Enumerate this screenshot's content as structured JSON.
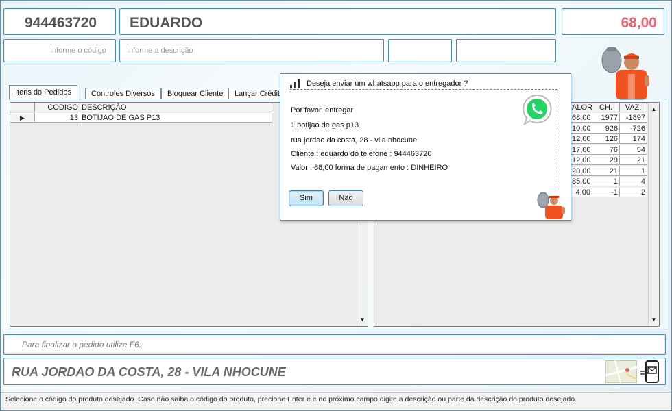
{
  "header": {
    "phone": "944463720",
    "customer_name": "EDUARDO",
    "total": "68,00"
  },
  "inputs": {
    "code_placeholder": "Informe o código",
    "description_placeholder": "Informe a descrição",
    "field3_value": "",
    "field4_value": ""
  },
  "tabs": [
    {
      "label": "Ítens do Pedidos",
      "active": true
    },
    {
      "label": "Controles Diversos"
    },
    {
      "label": "Bloquear Cliente"
    },
    {
      "label": "Lançar Crédito"
    }
  ],
  "order_grid": {
    "columns": [
      "CODIGO",
      "DESCRIÇÃO"
    ],
    "rows": [
      {
        "codigo": "13",
        "descricao": "BOTIJAO DE GAS P13"
      }
    ]
  },
  "stock_grid": {
    "columns": [
      "ALOR",
      "CH.",
      "VAZ."
    ],
    "rows": [
      {
        "valor": "68,00",
        "ch": "1977",
        "vaz": "-1897"
      },
      {
        "valor": "10,00",
        "ch": "926",
        "vaz": "-726"
      },
      {
        "valor": "12,00",
        "ch": "126",
        "vaz": "174"
      },
      {
        "valor": "17,00",
        "ch": "76",
        "vaz": "54"
      },
      {
        "valor": "12,00",
        "ch": "29",
        "vaz": "21"
      },
      {
        "valor": "20,00",
        "ch": "21",
        "vaz": "1"
      },
      {
        "valor": "85,00",
        "ch": "1",
        "vaz": "4"
      },
      {
        "valor": "4,00",
        "ch": "-1",
        "vaz": "2"
      }
    ]
  },
  "dialog": {
    "title": "Deseja enviar um whatsapp para o entregador ?",
    "lines": [
      "Por favor, entregar",
      "1 botijao de gas p13",
      "rua  jordao da costa, 28 - vila nhocune.",
      "Cliente : eduardo do telefone : 944463720",
      "Valor : 68,00 forma de pagamento : DINHEIRO"
    ],
    "yes_label": "Sim",
    "no_label": "Não"
  },
  "hint": "Para finalizar o pedido utilize F6.",
  "address": "RUA  JORDAO DA COSTA, 28 - VILA NHOCUNE",
  "status_bar": "Selecione o código do produto desejado. Caso não saiba o código do produto, precione Enter e e no próximo campo digite a descrição ou parte da descrição do produto desejado.",
  "icons": [
    "signal-icon",
    "whatsapp-icon",
    "delivery-man-image",
    "map-icon",
    "phone-message-icon",
    "row-pointer-icon"
  ],
  "colors": {
    "accent_border": "#4d8ea6",
    "total_color": "#e8636f",
    "whatsapp_green": "#25d366",
    "uniform_orange": "#f0531f"
  }
}
